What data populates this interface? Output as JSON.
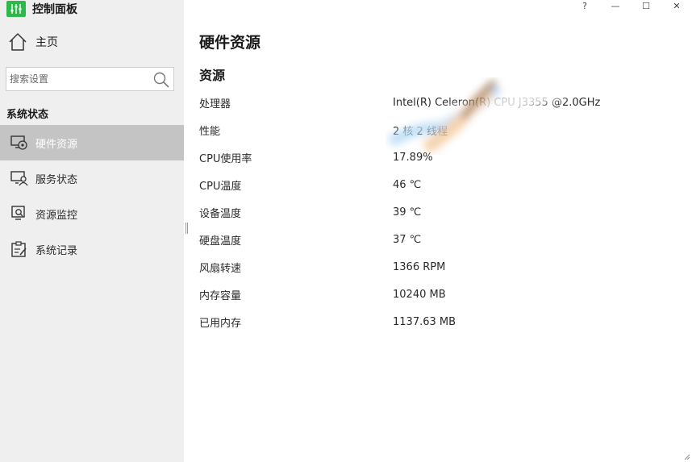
{
  "app": {
    "title": "控制面板",
    "accent": "#2fb84a"
  },
  "window": {
    "help": "?",
    "minimize": "—",
    "maximize": "☐",
    "close": "✕"
  },
  "sidebar": {
    "home": "主页",
    "search_placeholder": "搜索设置",
    "section": "系统状态",
    "items": [
      {
        "label": "硬件资源",
        "icon": "hardware-monitor-icon",
        "active": true
      },
      {
        "label": "服务状态",
        "icon": "service-user-icon",
        "active": false
      },
      {
        "label": "资源监控",
        "icon": "monitor-search-icon",
        "active": false
      },
      {
        "label": "系统记录",
        "icon": "clipboard-log-icon",
        "active": false
      }
    ]
  },
  "main": {
    "title": "硬件资源",
    "section": "资源",
    "rows": [
      {
        "key": "处理器",
        "value": "Intel(R) Celeron(R) CPU J3355 @2.0GHz"
      },
      {
        "key": "性能",
        "value": "2 核 2 线程"
      },
      {
        "key": "CPU使用率",
        "value": "17.89%"
      },
      {
        "key": "CPU温度",
        "value": "46 ℃"
      },
      {
        "key": "设备温度",
        "value": "39 ℃"
      },
      {
        "key": "硬盘温度",
        "value": "37 ℃"
      },
      {
        "key": "风扇转速",
        "value": "1366 RPM"
      },
      {
        "key": "内存容量",
        "value": "10240 MB"
      },
      {
        "key": "已用内存",
        "value": "1137.63 MB"
      }
    ]
  }
}
